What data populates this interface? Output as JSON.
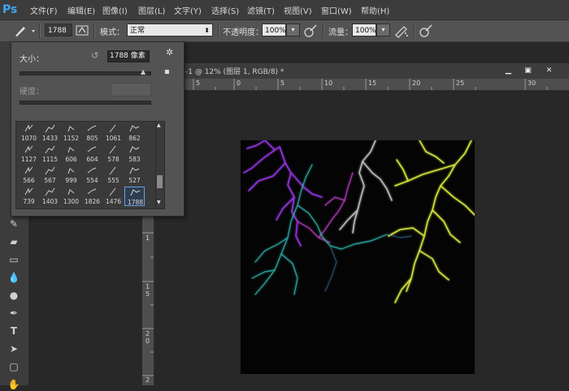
{
  "app": {
    "logo": "Ps"
  },
  "menu": [
    "文件(F)",
    "编辑(E)",
    "图像(I)",
    "图层(L)",
    "文字(Y)",
    "选择(S)",
    "滤镜(T)",
    "视图(V)",
    "窗口(W)",
    "帮助(H)"
  ],
  "options": {
    "brush_size": "1788",
    "mode_label": "模式：",
    "mode_value": "正常",
    "opacity_label": "不透明度：",
    "opacity_value": "100%",
    "flow_label": "流量：",
    "flow_value": "100%"
  },
  "document": {
    "title": "-1 @ 12% (图层 1, RGB/8) *",
    "ruler_top": [
      "5",
      "0",
      "5",
      "10",
      "15",
      "20",
      "25",
      "30"
    ],
    "ruler_left": [
      "1",
      "1\n5",
      "2\n0",
      "2"
    ]
  },
  "brush_popup": {
    "size_label": "大小：",
    "size_value": "1788 像素",
    "size_fraction": 0.95,
    "hardness_label": "硬度：",
    "brushes": [
      "1070",
      "1433",
      "1152",
      "805",
      "1061",
      "862",
      "1127",
      "1115",
      "606",
      "604",
      "578",
      "583",
      "566",
      "567",
      "999",
      "554",
      "555",
      "527",
      "739",
      "1403",
      "1300",
      "1826",
      "1476",
      "1788"
    ],
    "selected_brush": "1788"
  },
  "colors": {
    "accent": "#3fa5f0",
    "lightning_purple": "#9a36e8",
    "lightning_teal": "#2fb6b0",
    "lightning_gray": "#bdbdbd",
    "lightning_yellow": "#d6e63a",
    "lightning_magenta": "#c03cc8"
  }
}
